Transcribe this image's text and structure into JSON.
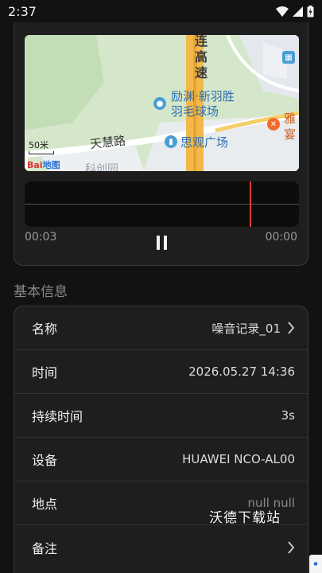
{
  "status_bar": {
    "time": "2:37"
  },
  "map": {
    "road_vertical": "连高速",
    "poi_1": "励渊·新羽胜",
    "poi_1_line2": "羽毛球场",
    "poi_2": "思观广场",
    "road_horizontal": "天慧路",
    "poi_3": "雅",
    "poi_3_line2": "宴",
    "scale": "50米",
    "logo": "Bai",
    "logo_suffix": "地图",
    "faded_text": "科创园"
  },
  "player": {
    "elapsed": "00:03",
    "remaining": "00:00",
    "playhead_fraction": 0.82
  },
  "section_title": "基本信息",
  "info_rows": [
    {
      "label": "名称",
      "value": "噪音记录_01"
    },
    {
      "label": "时间",
      "value": "2026.05.27 14:36"
    },
    {
      "label": "持续时间",
      "value": "3s"
    },
    {
      "label": "设备",
      "value": "HUAWEI NCO-AL00"
    },
    {
      "label": "地点",
      "value": "null null"
    },
    {
      "label": "备注",
      "value": ""
    }
  ],
  "watermark": "沃德下载站"
}
